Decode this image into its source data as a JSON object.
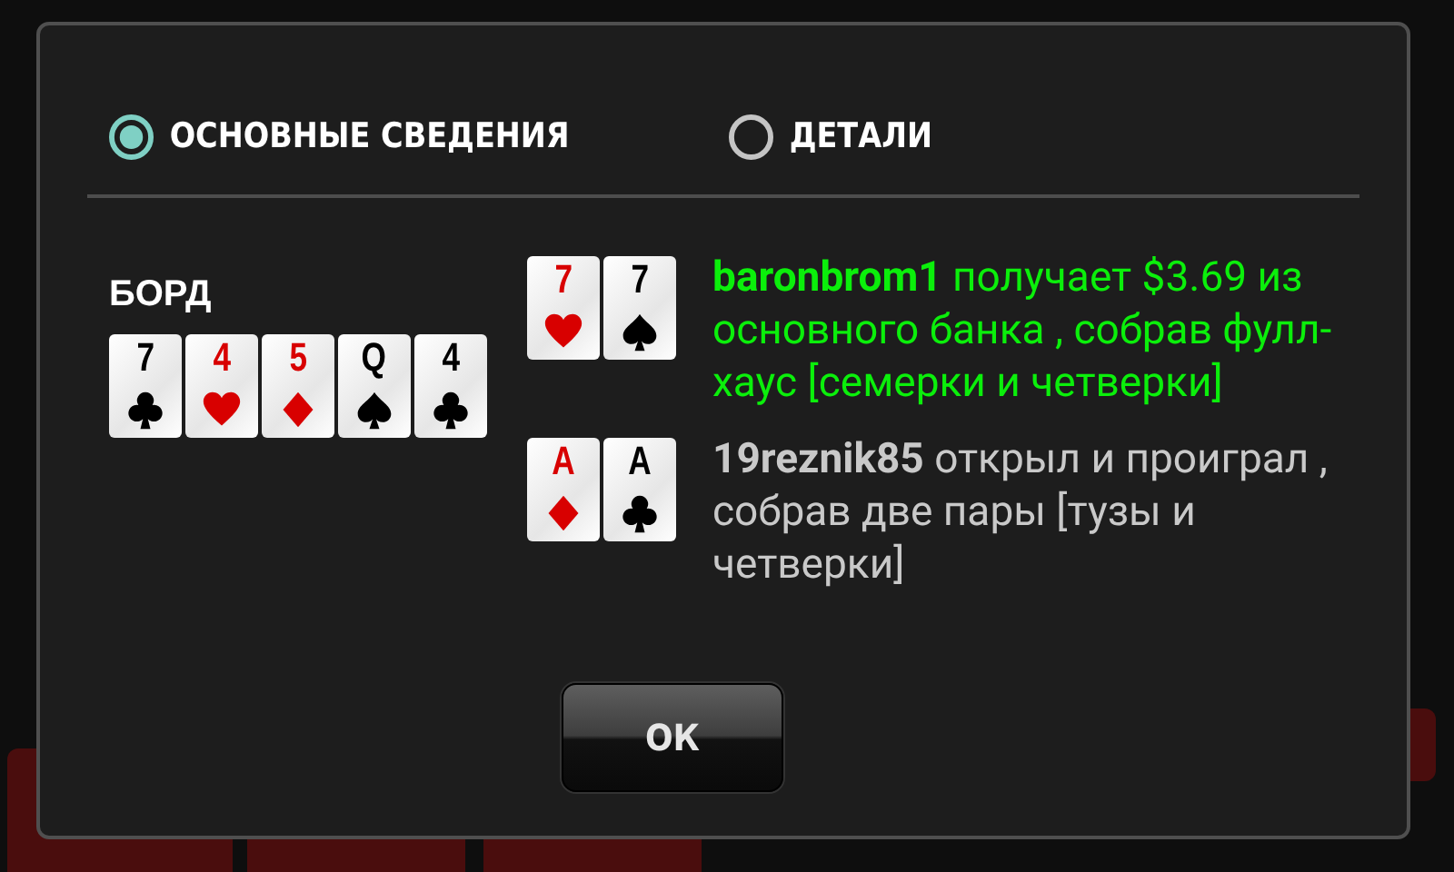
{
  "tabs": [
    {
      "label": "ОСНОВНЫЕ СВЕДЕНИЯ",
      "selected": true
    },
    {
      "label": "ДЕТАЛИ",
      "selected": false
    }
  ],
  "board": {
    "title": "БОРД",
    "cards": [
      {
        "rank": "7",
        "kind": "clubs"
      },
      {
        "rank": "4",
        "kind": "hearts"
      },
      {
        "rank": "5",
        "kind": "diamonds"
      },
      {
        "rank": "Q",
        "kind": "spades"
      },
      {
        "rank": "4",
        "kind": "clubs"
      }
    ]
  },
  "results": [
    {
      "won": true,
      "cards": [
        {
          "rank": "7",
          "kind": "hearts"
        },
        {
          "rank": "7",
          "kind": "spades"
        }
      ],
      "text": "**baronbrom1** получает $3.69 из основного банка , собрав фулл-хаус [семерки и четверки]"
    },
    {
      "won": false,
      "cards": [
        {
          "rank": "A",
          "kind": "diamonds"
        },
        {
          "rank": "A",
          "kind": "clubs"
        }
      ],
      "text": "**19reznik85** открыл и проиграл , собрав две пары [тузы и четверки]"
    }
  ],
  "ok_button": "ОК"
}
